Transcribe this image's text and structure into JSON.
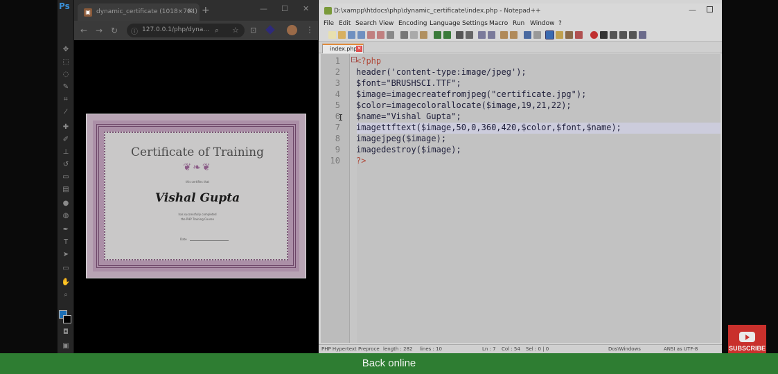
{
  "browser": {
    "tab_title": "dynamic_certificate (1018×764)",
    "url": "127.0.0.1/php/dyna..."
  },
  "certificate": {
    "title": "Certificate of Training",
    "intro": "this certifies that",
    "name": "Vishal Gupta",
    "line1": "has successfully completed",
    "line2": "the PHP Training Course",
    "date_label": "Date"
  },
  "editor": {
    "window_title": "D:\\xampp\\htdocs\\php\\dynamic_certificate\\index.php - Notepad++",
    "menu": [
      "File",
      "Edit",
      "Search",
      "View",
      "Encoding",
      "Language",
      "Settings",
      "Macro",
      "Run",
      "Window",
      "?"
    ],
    "tab_label": "index.php",
    "line_numbers": [
      "1",
      "2",
      "3",
      "4",
      "5",
      "6",
      "7",
      "8",
      "9",
      "10"
    ],
    "code": [
      "<?php",
      "header('content-type:image/jpeg');",
      "$font=\"BRUSHSCI.TTF\";",
      "$image=imagecreatefromjpeg(\"certificate.jpg\");",
      "$color=imagecolorallocate($image,19,21,22);",
      "$name=\"Vishal Gupta\";",
      "imagettftext($image,50,0,360,420,$color,$font,$name);",
      "imagejpeg($image);",
      "imagedestroy($image);",
      "?>"
    ],
    "status": {
      "type": "PHP Hypertext Preproce",
      "length": "length : 282",
      "lines": "lines : 10",
      "ln": "Ln : 7",
      "col": "Col : 54",
      "sel": "Sel : 0 | 0",
      "eol": "Dos\\Windows",
      "encoding": "ANSI as UTF-8"
    }
  },
  "overlay": {
    "subscribe": "SUBSCRIBE",
    "status_message": "Back online"
  },
  "colors": {
    "online_bar": "#2e7d32",
    "subscribe_bg": "#c9302c",
    "ps_foreground": "#1d6fb5"
  }
}
